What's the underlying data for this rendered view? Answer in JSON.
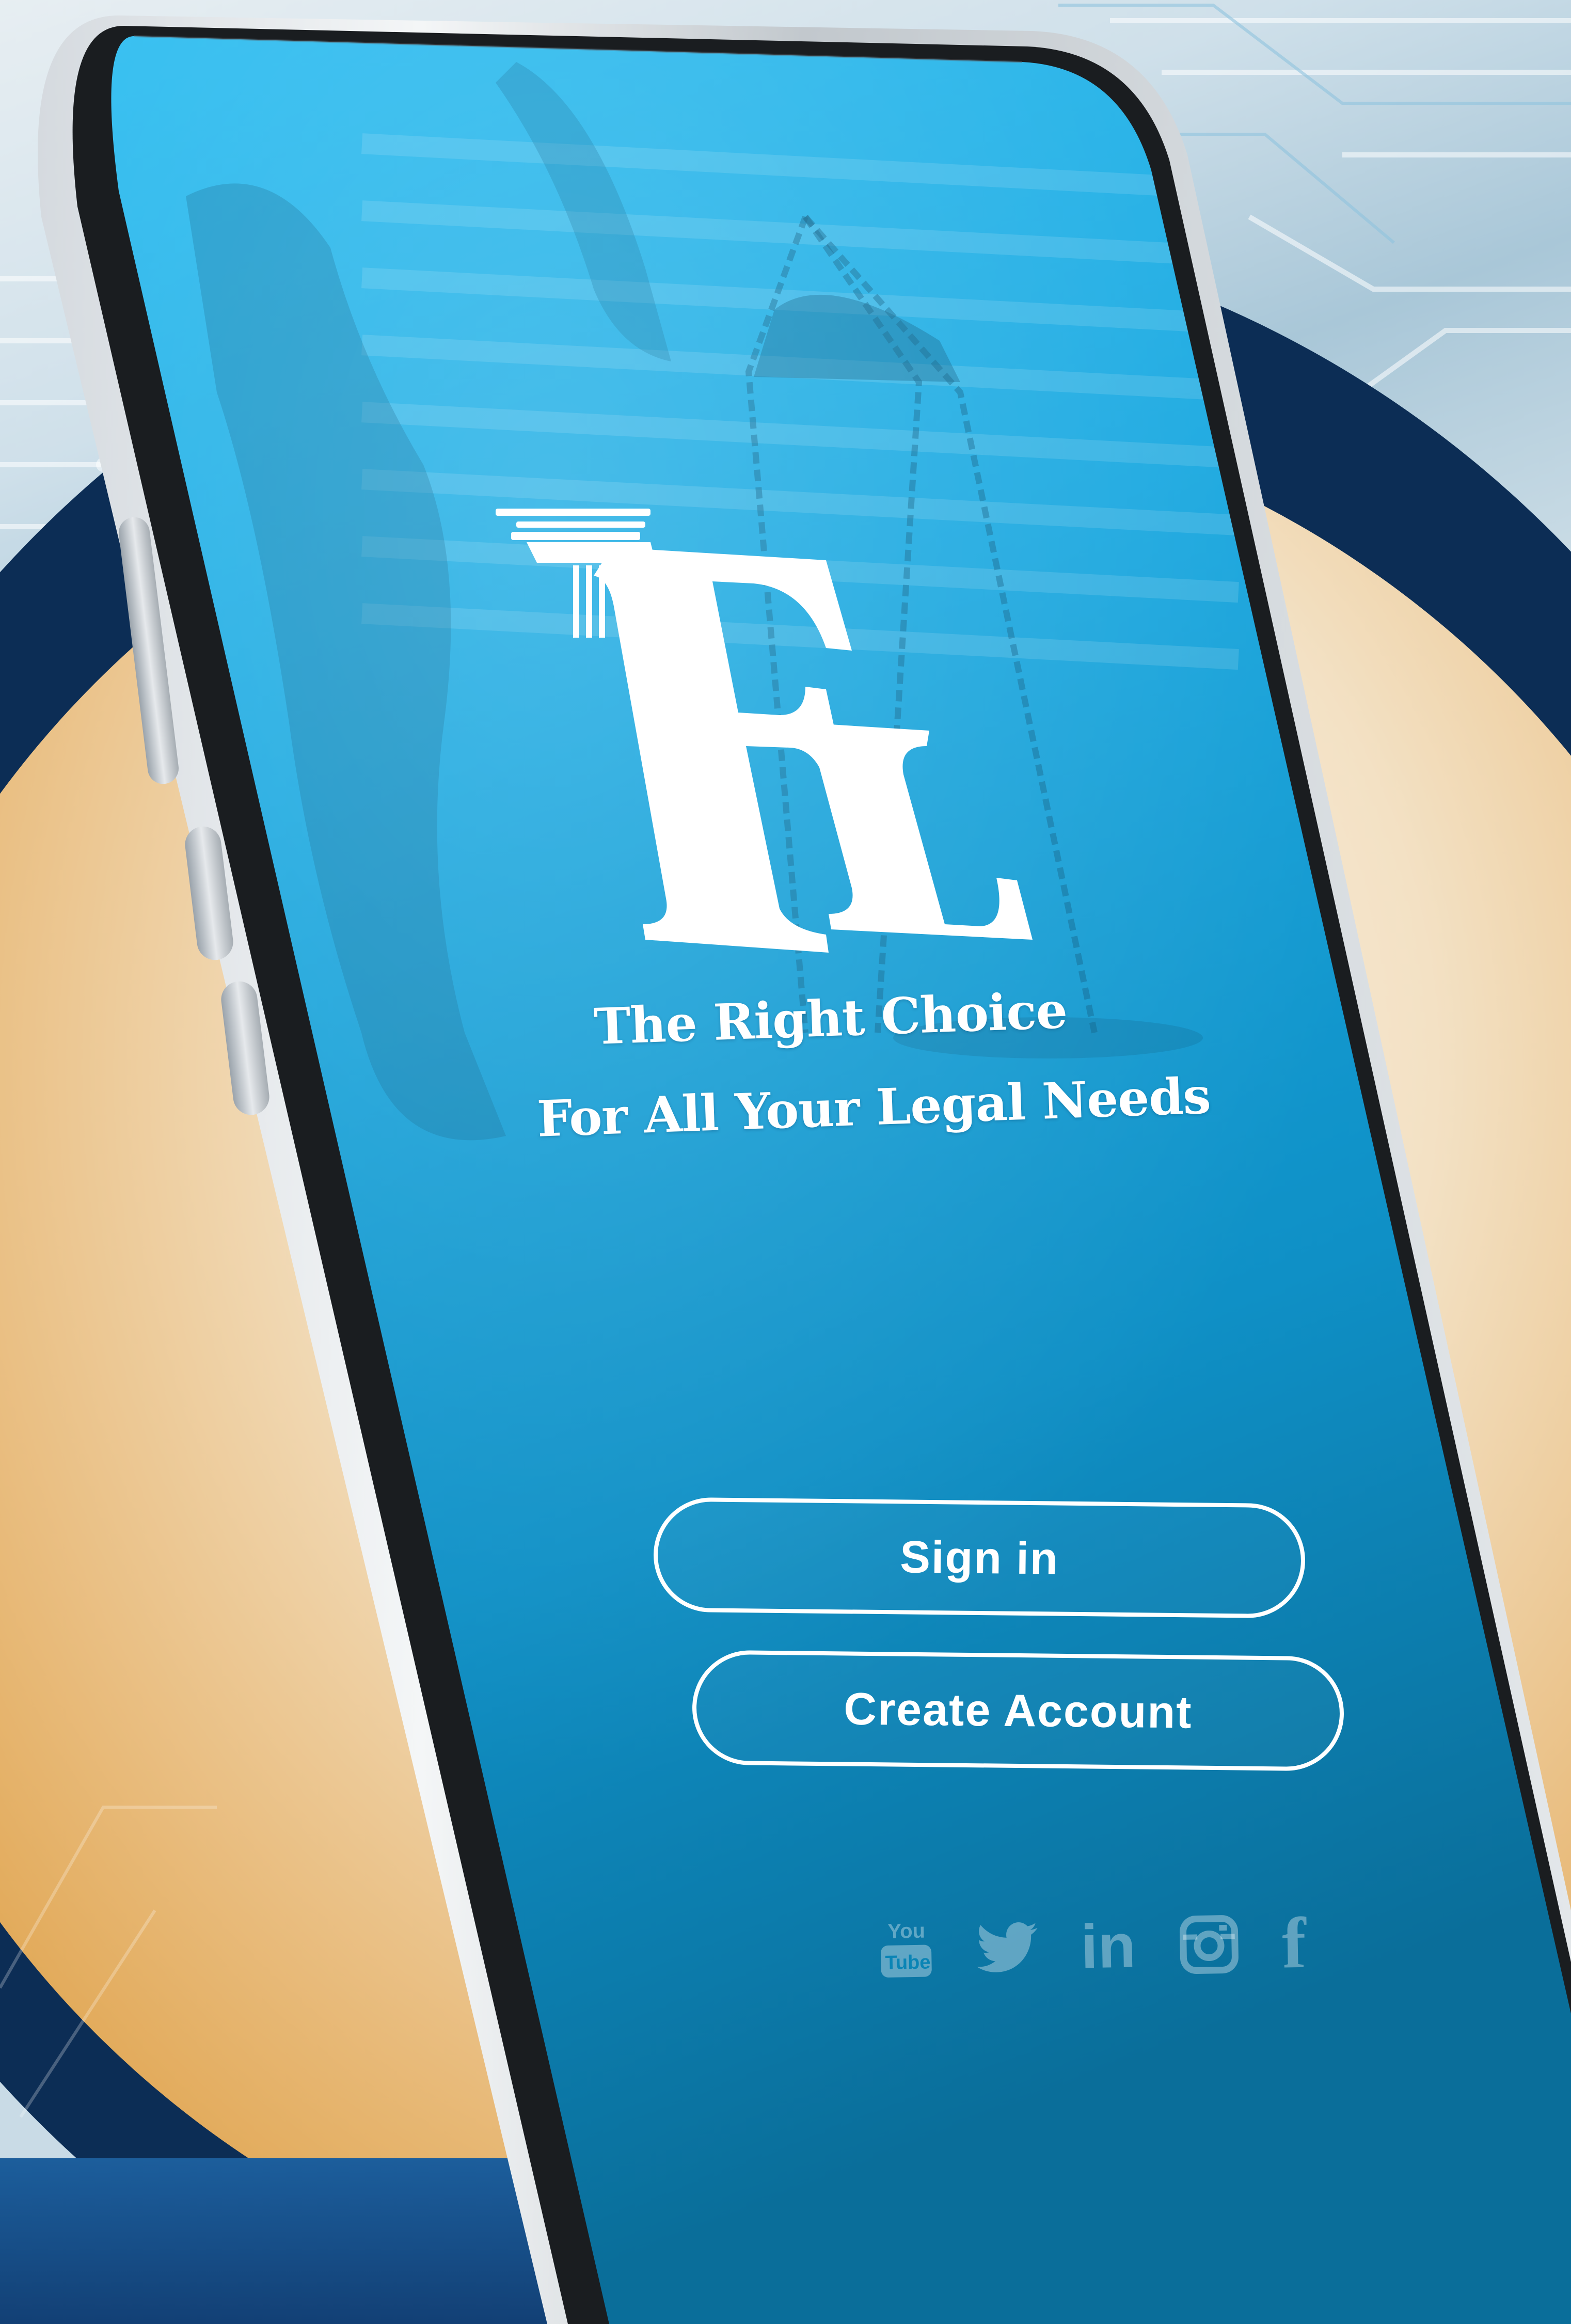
{
  "brand": {
    "logo_letters": "EL",
    "tagline_line1": "The Right Choice",
    "tagline_line2": "For All Your Legal Needs"
  },
  "auth": {
    "sign_in_label": "Sign in",
    "create_account_label": "Create Account"
  },
  "social": [
    {
      "icon": "youtube-icon",
      "label": "You Tube"
    },
    {
      "icon": "twitter-icon",
      "label": ""
    },
    {
      "icon": "linkedin-icon",
      "label": "in"
    },
    {
      "icon": "instagram-icon",
      "label": ""
    },
    {
      "icon": "facebook-icon",
      "label": "f"
    }
  ],
  "colors": {
    "screen_top": "#1faee8",
    "screen_bottom": "#0a7fb0",
    "ring": "#0c2d55",
    "warm": "#e9b46a",
    "text": "#ffffff"
  }
}
